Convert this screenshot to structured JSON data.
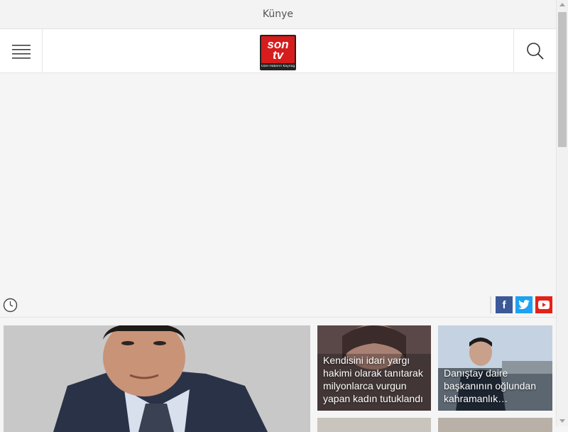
{
  "topbar": {
    "kunye_label": "Künye"
  },
  "header": {
    "logo": {
      "line1": "son",
      "line2": "tv",
      "tagline": "Özel Haberin Kaynağı"
    },
    "menu_icon": "hamburger-icon",
    "search_icon": "search-icon"
  },
  "infobar": {
    "clock_icon": "clock-icon",
    "socials": [
      {
        "name": "facebook-icon",
        "glyph": "f",
        "color": "#3b5998"
      },
      {
        "name": "twitter-icon",
        "glyph": "t",
        "color": "#1da1f2"
      },
      {
        "name": "youtube-icon",
        "glyph": "▶",
        "color": "#e62117"
      }
    ]
  },
  "news": {
    "cards": [
      {
        "title": "Kendisini idari yargı hakimi olarak tanıtarak milyonlarca vurgun yapan kadın tutuklandı"
      },
      {
        "title": "Danıştay daire başkanının oğlundan kahramanlık…"
      }
    ]
  },
  "colors": {
    "brand_red": "#d61c1c"
  }
}
